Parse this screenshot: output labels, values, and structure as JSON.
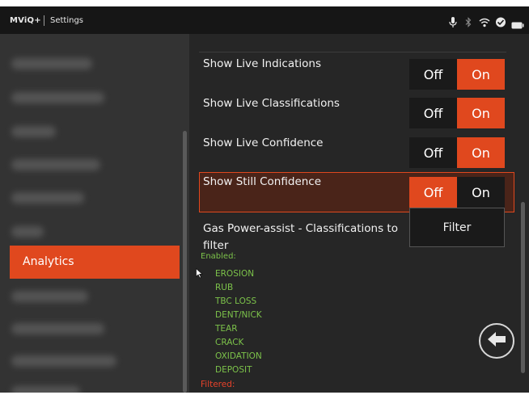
{
  "status_bar": {
    "brand": "MViQ+",
    "title": "Settings",
    "icons": [
      "microphone-icon",
      "bluetooth-icon",
      "wifi-icon",
      "sync-icon",
      "battery-icon"
    ]
  },
  "sidebar": {
    "selected_label": "Analytics"
  },
  "settings": [
    {
      "label": "Show Live Indications",
      "off_label": "Off",
      "on_label": "On",
      "selected": "on"
    },
    {
      "label": "Show Live Classifications",
      "off_label": "Off",
      "on_label": "On",
      "selected": "on"
    },
    {
      "label": "Show Live Confidence",
      "off_label": "Off",
      "on_label": "On",
      "selected": "on"
    },
    {
      "label": "Show Still Confidence",
      "off_label": "Off",
      "on_label": "On",
      "selected": "off"
    }
  ],
  "gas_filter": {
    "label_line1": "Gas Power-assist - Classifications to",
    "label_line2": "filter",
    "button_label": "Filter",
    "enabled_label": "Enabled:",
    "enabled_items": [
      "EROSION",
      "RUB",
      "TBC LOSS",
      "DENT/NICK",
      "TEAR",
      "CRACK",
      "OXIDATION",
      "DEPOSIT"
    ],
    "filtered_label": "Filtered:"
  },
  "colors": {
    "accent": "#e0481e",
    "enabled_green": "#7cc24a",
    "filtered_red": "#e8422a",
    "panel_bg": "#262626",
    "sidebar_bg": "#333333"
  }
}
